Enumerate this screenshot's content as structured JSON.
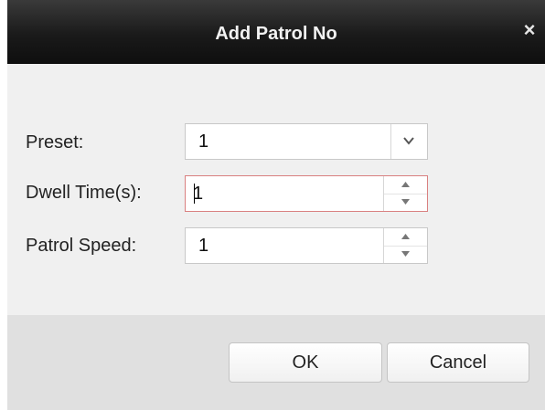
{
  "dialog": {
    "title": "Add Patrol No",
    "close_icon": "close-icon",
    "close_glyph": "×"
  },
  "form": {
    "preset": {
      "label": "Preset:",
      "value": "1"
    },
    "dwell_time": {
      "label": "Dwell Time(s):",
      "value": "1"
    },
    "patrol_speed": {
      "label": "Patrol Speed:",
      "value": "1"
    }
  },
  "buttons": {
    "ok": "OK",
    "cancel": "Cancel"
  },
  "colors": {
    "titlebar": "#1a1a1a",
    "body": "#f0f0f0",
    "footer": "#e0e0e0",
    "focus_border": "#d98080"
  }
}
